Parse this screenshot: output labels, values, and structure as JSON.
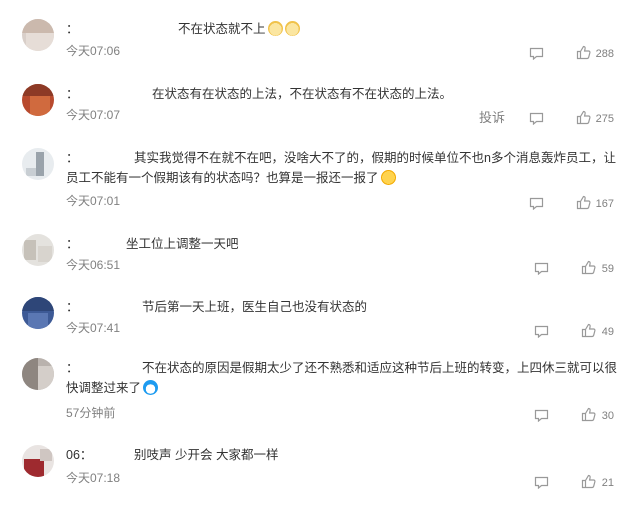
{
  "colors": {
    "text": "#333333",
    "meta": "#808080",
    "icon": "#999999",
    "name_tail": "#ec9ba3"
  },
  "comments": [
    {
      "name_tail": "",
      "text": "不在状态就不上",
      "emojis": [
        "dog",
        "dog"
      ],
      "time": "今天07:06",
      "likes": "288",
      "report": ""
    },
    {
      "name_tail": "",
      "text": "在状态有在状态的上法，不在状态有不在状态的上法。",
      "emojis": [],
      "time": "今天07:07",
      "likes": "275",
      "report": "投诉"
    },
    {
      "name_tail": "",
      "text": "其实我觉得不在就不在吧，没啥大不了的，假期的时候单位不也n多个消息轰炸员工，让员工不能有一个假期该有的状态吗？也算是一报还一报了",
      "emojis": [
        "laugh"
      ],
      "time": "今天07:01",
      "likes": "167",
      "report": ""
    },
    {
      "name_tail": "",
      "text": "坐工位上调整一天吧",
      "emojis": [],
      "time": "今天06:51",
      "likes": "59",
      "report": ""
    },
    {
      "name_tail": "",
      "text": "节后第一天上班，医生自己也没有状态的",
      "emojis": [],
      "time": "今天07:41",
      "likes": "49",
      "report": ""
    },
    {
      "name_tail": "",
      "text": "不在状态的原因是假期太少了还不熟悉和适应这种节后上班的转变，上四休三就可以很快调整过来了",
      "emojis": [
        "doraemon"
      ],
      "time": "57分钟前",
      "likes": "30",
      "report": ""
    },
    {
      "name_tail": "06",
      "text": "别吱声 少开会 大家都一样",
      "emojis": [],
      "time": "今天07:18",
      "likes": "21",
      "report": ""
    }
  ]
}
